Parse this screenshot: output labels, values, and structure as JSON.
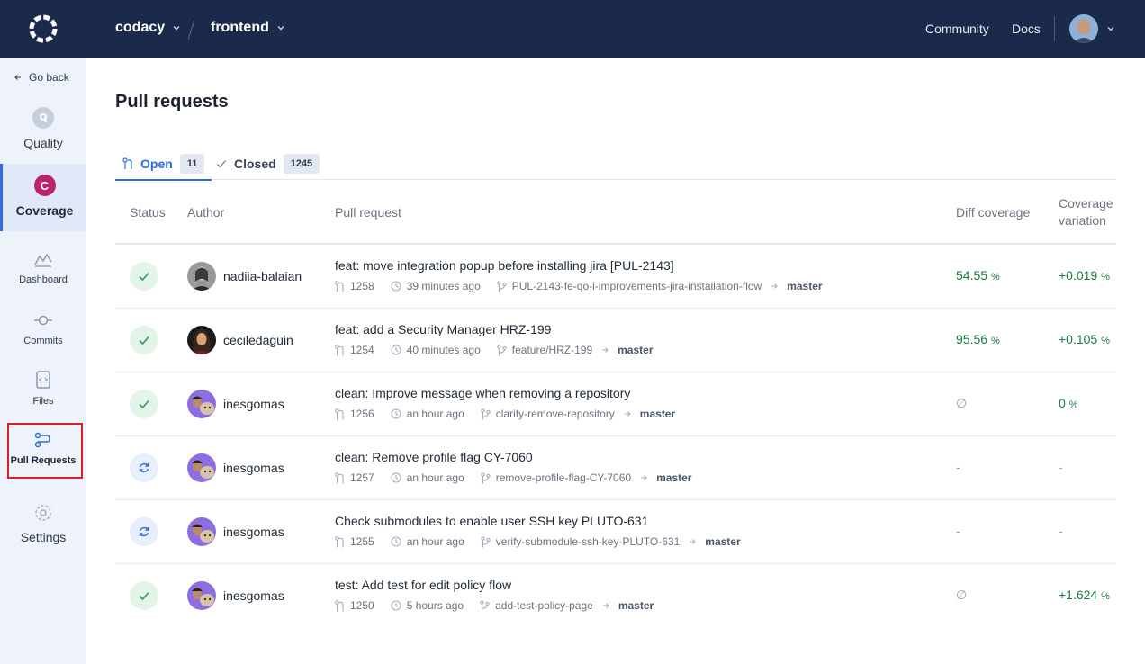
{
  "topbar": {
    "org": "codacy",
    "repo": "frontend",
    "links": [
      "Community",
      "Docs"
    ]
  },
  "sidebar": {
    "go_back": "Go back",
    "items": [
      {
        "label": "Quality",
        "icon": "quality-icon"
      },
      {
        "label": "Coverage",
        "icon": "coverage-icon",
        "letter": "C"
      },
      {
        "label": "Dashboard",
        "icon": "chart-icon"
      },
      {
        "label": "Commits",
        "icon": "commit-icon"
      },
      {
        "label": "Files",
        "icon": "file-icon"
      },
      {
        "label": "Pull Requests",
        "icon": "pull-request-icon"
      },
      {
        "label": "Settings",
        "icon": "gear-icon"
      }
    ]
  },
  "page": {
    "title": "Pull requests",
    "tabs": [
      {
        "label": "Open",
        "count": "11"
      },
      {
        "label": "Closed",
        "count": "1245"
      }
    ]
  },
  "table": {
    "headers": {
      "status": "Status",
      "author": "Author",
      "pull_request": "Pull request",
      "diff_coverage": "Diff coverage",
      "coverage_variation_line1": "Coverage",
      "coverage_variation_line2": "variation"
    },
    "rows": [
      {
        "status": "ok",
        "author": "nadiia-balaian",
        "title": "feat: move integration popup before installing jira [PUL-2143]",
        "number": "1258",
        "time": "39 minutes ago",
        "branch": "PUL-2143-fe-qo-i-improvements-jira-installation-flow",
        "target": "master",
        "diff": "54.55",
        "diff_unit": "%",
        "variation": "+0.019",
        "variation_unit": "%"
      },
      {
        "status": "ok",
        "author": "ceciledaguin",
        "title": "feat: add a Security Manager HRZ-199",
        "number": "1254",
        "time": "40 minutes ago",
        "branch": "feature/HRZ-199",
        "target": "master",
        "diff": "95.56",
        "diff_unit": "%",
        "variation": "+0.105",
        "variation_unit": "%"
      },
      {
        "status": "ok",
        "author": "inesgomas",
        "title": "clean: Improve message when removing a repository",
        "number": "1256",
        "time": "an hour ago",
        "branch": "clarify-remove-repository",
        "target": "master",
        "diff": "∅",
        "diff_unit": "",
        "variation": "0",
        "variation_unit": "%"
      },
      {
        "status": "pending",
        "author": "inesgomas",
        "title": "clean: Remove profile flag CY-7060",
        "number": "1257",
        "time": "an hour ago",
        "branch": "remove-profile-flag-CY-7060",
        "target": "master",
        "diff": "-",
        "diff_unit": "",
        "variation": "-",
        "variation_unit": ""
      },
      {
        "status": "pending",
        "author": "inesgomas",
        "title": "Check submodules to enable user SSH key PLUTO-631",
        "number": "1255",
        "time": "an hour ago",
        "branch": "verify-submodule-ssh-key-PLUTO-631",
        "target": "master",
        "diff": "-",
        "diff_unit": "",
        "variation": "-",
        "variation_unit": ""
      },
      {
        "status": "ok",
        "author": "inesgomas",
        "title": "test: Add test for edit policy flow",
        "number": "1250",
        "time": "5 hours ago",
        "branch": "add-test-policy-page",
        "target": "master",
        "diff": "∅",
        "diff_unit": "",
        "variation": "+1.624",
        "variation_unit": "%"
      }
    ]
  },
  "colors": {
    "topbar": "#1b2a4a",
    "accent": "#2d6cdf",
    "positive": "#1c7a3a",
    "coverage_badge": "#b8256b",
    "highlight": "#d61f26"
  }
}
